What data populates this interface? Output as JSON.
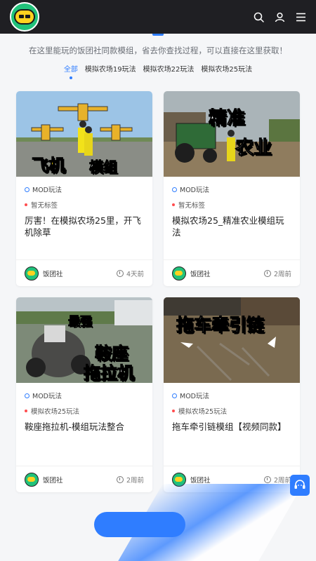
{
  "header": {
    "logo_alt": "饭团社",
    "icons": [
      "search-icon",
      "user-icon",
      "menu-icon"
    ]
  },
  "intro_text": "在这里能玩的饭团社同款模组，省去你查找过程，可以直接在这里获取！",
  "tabs": [
    {
      "label": "全部",
      "active": true
    },
    {
      "label": "模拟农场19玩法",
      "active": false
    },
    {
      "label": "模拟农场22玩法",
      "active": false
    },
    {
      "label": "模拟农场25玩法",
      "active": false
    }
  ],
  "cards": [
    {
      "thumb_text": [
        "飞机",
        "模组"
      ],
      "category": "MOD玩法",
      "tag": "暂无标签",
      "title": "厉害！在模拟农场25里，开飞机除草",
      "author": "饭团社",
      "time": "4天前"
    },
    {
      "thumb_text": [
        "精准",
        "农业"
      ],
      "category": "MOD玩法",
      "tag": "暂无标签",
      "title": "模拟农场25_精准农业模组玩法",
      "author": "饭团社",
      "time": "2周前"
    },
    {
      "thumb_text": [
        "最强",
        "鞍座",
        "拖拉机"
      ],
      "category": "MOD玩法",
      "tag": "模拟农场25玩法",
      "title": "鞍座拖拉机-模组玩法整合",
      "author": "饭团社",
      "time": "2周前"
    },
    {
      "thumb_text": [
        "拖车牵引链"
      ],
      "category": "MOD玩法",
      "tag": "模拟农场25玩法",
      "title": "拖车牵引链模组【视频同款】",
      "author": "饭团社",
      "time": "2周前"
    }
  ],
  "colors": {
    "accent": "#2f7dff",
    "topbar": "#1f1f23",
    "tag_dot": "#ff4d4f"
  }
}
